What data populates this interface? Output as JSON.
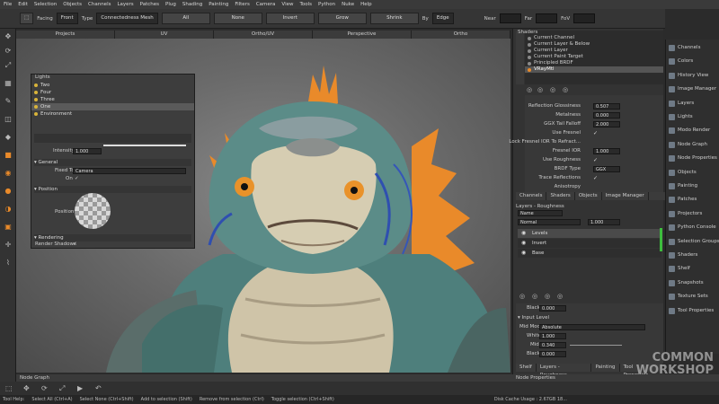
{
  "menu": [
    "File",
    "Edit",
    "Selection",
    "Objects",
    "Channels",
    "Layers",
    "Patches",
    "Plug",
    "Shading",
    "Painting",
    "Filters",
    "Camera",
    "View",
    "Tools",
    "Python",
    "Nuke",
    "Help"
  ],
  "toolbar": {
    "facing_label": "Facing",
    "facing_value": "Front",
    "type_label": "Type",
    "type_value": "Connectedness Mesh",
    "all": "All",
    "none": "None",
    "invert": "Invert",
    "grow": "Grow",
    "shrink": "Shrink",
    "by_label": "By",
    "by_value": "Edge",
    "near_label": "Near",
    "far_label": "Far",
    "fov_label": "FoV"
  },
  "viewport_tabs": [
    "Projects",
    "UV",
    "Ortho/UV",
    "Perspective",
    "Ortho"
  ],
  "lights": {
    "title": "Lights",
    "items": [
      "Two",
      "Four",
      "Three",
      "One",
      "Environment"
    ],
    "selected_index": 3,
    "intensity_label": "Intensity",
    "intensity_value": "1.000",
    "general_label": "General",
    "fixed_to_label": "Fixed To",
    "fixed_to_value": "Camera",
    "on_label": "On",
    "position_label": "Position",
    "position_field_label": "Position",
    "rendering_label": "Rendering",
    "render_shadows_label": "Render Shadows"
  },
  "shaders": {
    "title": "Shaders",
    "items": [
      "Current Channel",
      "Current Layer & Below",
      "Current Layer",
      "Current Paint Target",
      "Principled BRDF",
      "VRayMtl"
    ],
    "selected_index": 5
  },
  "properties": [
    {
      "label": "Reflection Glossiness",
      "value": "0.507",
      "kind": "num"
    },
    {
      "label": "Metalness",
      "value": "0.000",
      "kind": "num"
    },
    {
      "label": "GGX Tail Falloff",
      "value": "2.000",
      "kind": "num"
    },
    {
      "label": "Use Fresnel",
      "value": "✓",
      "kind": "check"
    },
    {
      "label": "Lock Fresnel IOR To Refract...",
      "value": "",
      "kind": "check"
    },
    {
      "label": "Fresnel IOR",
      "value": "1.000",
      "kind": "num"
    },
    {
      "label": "Use Roughness",
      "value": "✓",
      "kind": "check"
    },
    {
      "label": "BRDF Type",
      "value": "GGX",
      "kind": "num"
    },
    {
      "label": "Trace Reflections",
      "value": "✓",
      "kind": "check"
    },
    {
      "label": "Anisotropy",
      "value": "",
      "kind": "check"
    }
  ],
  "mid_tabs": [
    "Channels",
    "Shaders",
    "Objects",
    "Image Manager"
  ],
  "layers": {
    "title": "Layers - Roughness",
    "name_label": "Name",
    "blend_value": "Normal",
    "opacity_value": "1.000",
    "items": [
      "Levels",
      "Invert",
      "Base"
    ],
    "selected_index": 0
  },
  "levels": {
    "black_label": "Black",
    "black_value": "0.000",
    "input_level_label": "Input Level",
    "mid_mode_label": "Mid Mode",
    "mid_mode_value": "Absolute",
    "white_label": "White",
    "white_value": "1.000",
    "mid_label": "Mid",
    "mid_value": "0.340",
    "black2_label": "Black",
    "black2_value": "0.000"
  },
  "bottom_tabs": [
    "Shelf",
    "Layers - Roughness",
    "Painting",
    "Tool Properties"
  ],
  "side_panels": [
    "Channels",
    "Colors",
    "History View",
    "Image Manager",
    "Layers",
    "Lights",
    "Modo Render",
    "Node Graph",
    "Node Properties",
    "Objects",
    "Painting",
    "Patches",
    "Projectors",
    "Python Console",
    "Selection Groups",
    "Shaders",
    "Shelf",
    "Snapshots",
    "Texture Sets",
    "Tool Properties"
  ],
  "node_graph_label": "Node Graph",
  "node_props_label": "Node Properties",
  "status": {
    "help": "Tool Help:",
    "select_all": "Select All (Ctrl+A)",
    "select_none": "Select None (Ctrl+Shift)",
    "add": "Add to selection (Shift)",
    "remove": "Remove from selection (Ctrl)",
    "toggle": "Toggle selection (Ctrl+Shift)",
    "disk_cache": "Disk Cache Usage : 2.67GB 18...",
    "watermark_1": "COMMON",
    "watermark_2": "WORKSHOP"
  },
  "colors": {
    "accent_orange": "#e98a2a",
    "creature_teal": "#4e7f7c",
    "selected_row": "#5a5a5a"
  }
}
